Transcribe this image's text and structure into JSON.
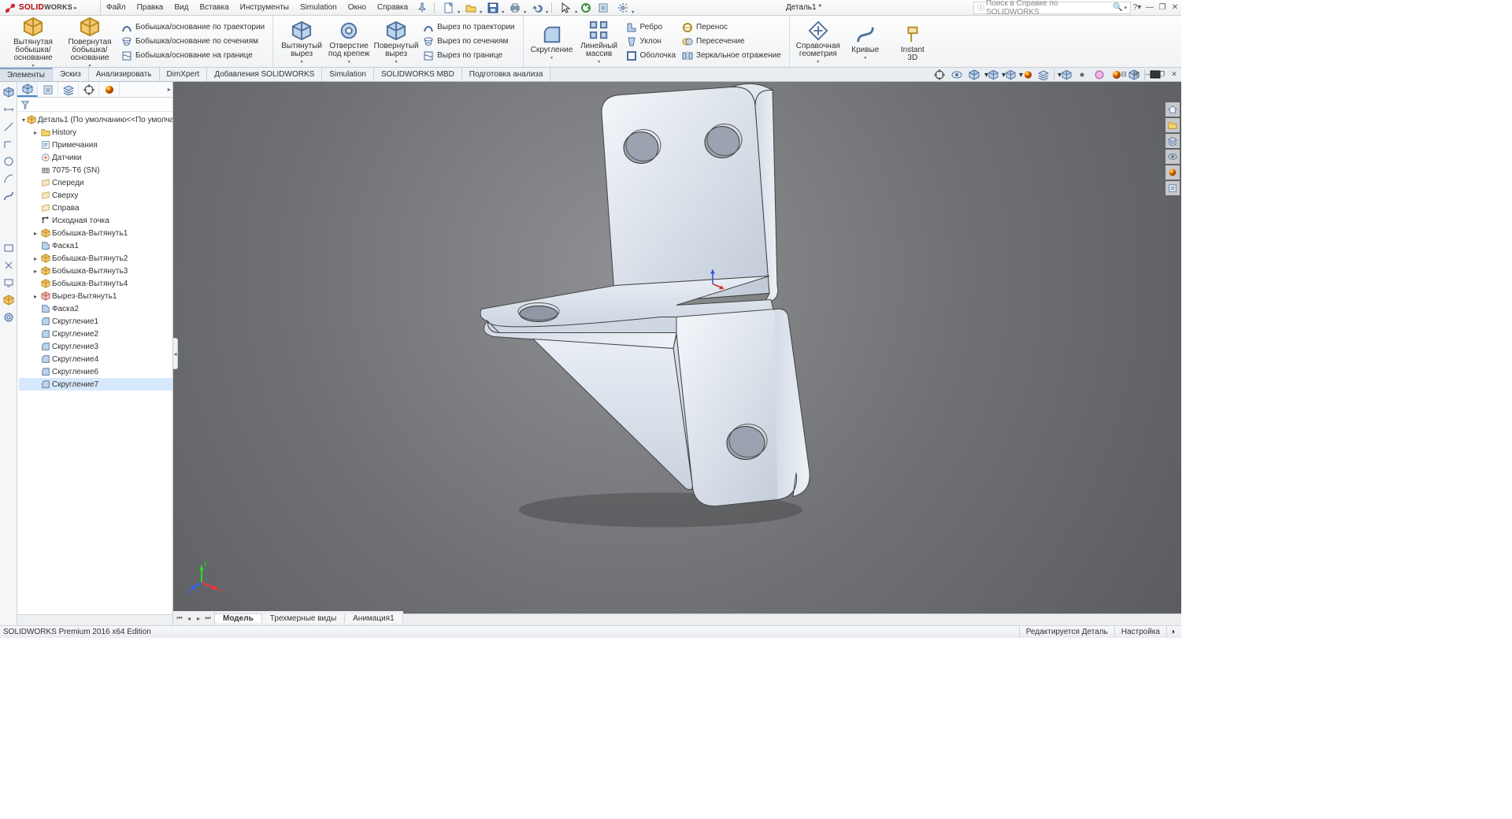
{
  "app": {
    "name_solid": "SOLID",
    "name_works": "WORKS",
    "doc_title": "Деталь1 *"
  },
  "menu": [
    "Файл",
    "Правка",
    "Вид",
    "Вставка",
    "Инструменты",
    "Simulation",
    "Окно",
    "Справка"
  ],
  "search": {
    "placeholder": "Поиск в Справке по SOLIDWORKS"
  },
  "ribbon": {
    "g1": [
      {
        "label": "Вытянутая\nбобышка/основание"
      },
      {
        "label": "Повернутая\nбобышка/основание"
      }
    ],
    "g1s": [
      "Бобышка/основание по траектории",
      "Бобышка/основание по сечениям",
      "Бобышка/основание на границе"
    ],
    "g2": [
      {
        "label": "Вытянутый\nвырез"
      },
      {
        "label": "Отверстие\nпод крепеж"
      },
      {
        "label": "Повернутый\nвырез"
      }
    ],
    "g2s": [
      "Вырез по траектории",
      "Вырез по сечениям",
      "Вырез по границе"
    ],
    "g3": [
      {
        "label": "Скругление"
      },
      {
        "label": "Линейный\nмассив"
      }
    ],
    "g3s": [
      "Ребро",
      "Уклон",
      "Оболочка"
    ],
    "g3s2": [
      "Перенос",
      "Пересечение",
      "Зеркальное отражение"
    ],
    "g4": [
      {
        "label": "Справочная\nгеометрия"
      },
      {
        "label": "Кривые"
      },
      {
        "label": "Instant\n3D"
      }
    ]
  },
  "ftabs": [
    "Элементы",
    "Эскиз",
    "Анализировать",
    "DimXpert",
    "Добавления SOLIDWORKS",
    "Simulation",
    "SOLIDWORKS MBD",
    "Подготовка анализа"
  ],
  "tree": {
    "root": "Деталь1  (По умолчанию<<По умолчан",
    "items": [
      {
        "t": "History",
        "exp": true,
        "ic": "folder"
      },
      {
        "t": "Примечания",
        "ic": "note"
      },
      {
        "t": "Датчики",
        "ic": "sensor"
      },
      {
        "t": "7075-T6 (SN)",
        "ic": "material"
      },
      {
        "t": "Спереди",
        "ic": "plane"
      },
      {
        "t": "Сверху",
        "ic": "plane"
      },
      {
        "t": "Справа",
        "ic": "plane"
      },
      {
        "t": "Исходная точка",
        "ic": "origin"
      },
      {
        "t": "Бобышка-Вытянуть1",
        "exp": true,
        "ic": "extrude"
      },
      {
        "t": "Фаска1",
        "ic": "chamfer"
      },
      {
        "t": "Бобышка-Вытянуть2",
        "exp": true,
        "ic": "extrude"
      },
      {
        "t": "Бобышка-Вытянуть3",
        "exp": true,
        "ic": "extrude"
      },
      {
        "t": "Бобышка-Вытянуть4",
        "ic": "extrude"
      },
      {
        "t": "Вырез-Вытянуть1",
        "exp": true,
        "ic": "cut"
      },
      {
        "t": "Фаска2",
        "ic": "chamfer"
      },
      {
        "t": "Скругление1",
        "ic": "fillet"
      },
      {
        "t": "Скругление2",
        "ic": "fillet"
      },
      {
        "t": "Скругление3",
        "ic": "fillet"
      },
      {
        "t": "Скругление4",
        "ic": "fillet"
      },
      {
        "t": "Скругление6",
        "ic": "fillet"
      },
      {
        "t": "Скругление7",
        "ic": "fillet",
        "sel": true
      }
    ]
  },
  "btabs": [
    "Модель",
    "Трехмерные виды",
    "Анимация1"
  ],
  "status": {
    "edition": "SOLIDWORKS Premium 2016 x64 Edition",
    "mode": "Редактируется Деталь",
    "setting": "Настройка"
  },
  "triad": {
    "x": "x",
    "y": "y",
    "z": "z"
  }
}
